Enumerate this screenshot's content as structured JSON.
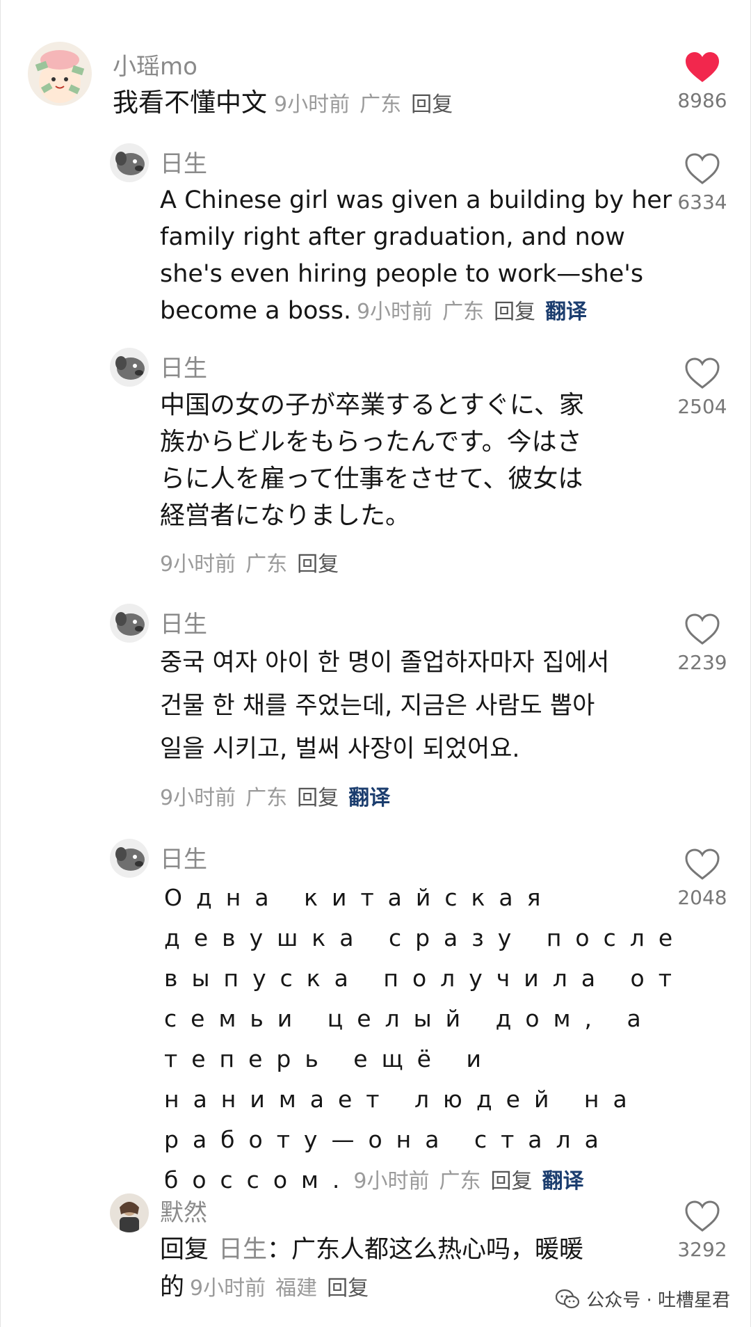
{
  "comments": [
    {
      "user": "小瑶mo",
      "text": [
        "我看不懂中文"
      ],
      "time": "9小时前",
      "location": "广东",
      "reply": "回复",
      "likes": "8986",
      "liked": true
    },
    {
      "user": "日生",
      "text": [
        "A Chinese girl was given a building by her",
        "family right after graduation, and now",
        "she's even hiring people to work—she's",
        "become a boss."
      ],
      "time": "9小时前",
      "location": "广东",
      "reply": "回复",
      "translate": "翻译",
      "likes": "6334",
      "liked": false
    },
    {
      "user": "日生",
      "text": [
        "中国の女の子が卒業するとすぐに、家",
        "族からビルをもらったんです。今はさ",
        "らに人を雇って仕事をさせて、彼女は",
        "経営者になりました。"
      ],
      "time": "9小时前",
      "location": "广东",
      "reply": "回复",
      "likes": "2504",
      "liked": false
    },
    {
      "user": "日生",
      "text": [
        "중국 여자 아이 한 명이 졸업하자마자 집에서",
        "건물 한 채를 주었는데, 지금은 사람도 뽑아",
        "일을 시키고, 벌써 사장이 되었어요."
      ],
      "time": "9小时前",
      "location": "广东",
      "reply": "回复",
      "translate": "翻译",
      "likes": "2239",
      "liked": false
    },
    {
      "user": "日生",
      "text": [
        "Одна китайская",
        "девушка сразу после",
        "выпуска получила от",
        "семьи целый дом, а",
        "теперь ещё и",
        "нанимает людей на",
        "работу—она стала",
        "боссом."
      ],
      "time": "9小时前",
      "location": "广东",
      "reply": "回复",
      "translate": "翻译",
      "likes": "2048",
      "liked": false
    },
    {
      "user": "默然",
      "reply_prefix": "回复",
      "reply_to": "日生",
      "text": [
        "广东人都这么热心吗，暖暖",
        "的"
      ],
      "time": "9小时前",
      "location": "福建",
      "reply": "回复",
      "likes": "3292",
      "liked": false
    }
  ],
  "watermark": {
    "icon": "wechat-official-account-icon",
    "text": "公众号 · 吐槽星君"
  },
  "colors": {
    "liked_heart": "#f2274d",
    "translate": "#1b3d6e",
    "meta": "#9a9a9a",
    "username": "#8a8a8a"
  }
}
